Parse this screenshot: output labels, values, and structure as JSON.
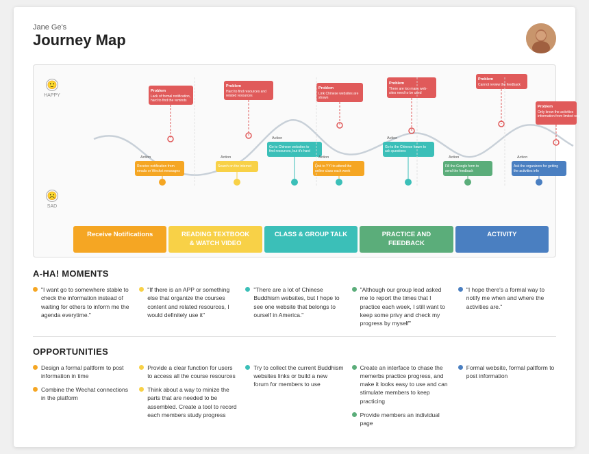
{
  "header": {
    "subtitle": "Jane Ge's",
    "title": "Journey Map"
  },
  "categories": [
    {
      "id": "receive-notifications",
      "label": "Receive Notifications",
      "color": "cat-orange"
    },
    {
      "id": "reading-textbook",
      "label": "READING TEXTBOOK\n& WATCH VIDEO",
      "color": "cat-yellow"
    },
    {
      "id": "class-group-talk",
      "label": "CLASS & GROUP TALK",
      "color": "cat-teal"
    },
    {
      "id": "practice-feedback",
      "label": "PRACTICE AND FEEDBACK",
      "color": "cat-green"
    },
    {
      "id": "activity",
      "label": "ACTIVITY",
      "color": "cat-blue"
    }
  ],
  "aha_moments": {
    "title": "A-HA! MOMENTS",
    "items": [
      {
        "dot": "dot-orange",
        "text": "\"I want go to somewhere stable to check the information instead of waiting for others to inform me the agenda everytime.\""
      },
      {
        "dot": "dot-yellow",
        "text": "\"If there is an APP or something else that organize the courses content and related resources, I would definitely use it\""
      },
      {
        "dot": "dot-teal",
        "text": "\"There are a lot of Chinese Buddhism websites, but I hope to see one website that belongs to ourself in America.\""
      },
      {
        "dot": "dot-green",
        "text": "\"Although our group lead asked me to report the times that I practice each week, I still want to keep some privy and check my progress by myself\""
      },
      {
        "dot": "dot-blue",
        "text": "\"I hope there's a formal way to notify me when and where the activities are.\""
      }
    ]
  },
  "opportunities": {
    "title": "OPPORTUNITIES",
    "items": [
      {
        "dot": "dot-orange",
        "text": "Design a formal paltform to post information in time"
      },
      {
        "dot": "dot-orange",
        "text": "Combine the Wechat connections in the platform"
      },
      {
        "dot": "dot-yellow",
        "text": "Provide a clear function for users to access all the course resources"
      },
      {
        "dot": "dot-yellow",
        "text": "Think about a way to minize the parts that are needed to be assembled. Create a tool to record each members study progress"
      },
      {
        "dot": "dot-teal",
        "text": "Try to collect the current Buddhism websites links or build a new forum for members to use"
      },
      {
        "dot": "dot-green",
        "text": "Create an interface to chase the memerbs practice progress, and make it looks easy to use and can stimulate members to keep practicing"
      },
      {
        "dot": "dot-green",
        "text": "Provide members an individual page"
      },
      {
        "dot": "dot-blue",
        "text": "Formal website, formal paltform to post information"
      }
    ]
  }
}
